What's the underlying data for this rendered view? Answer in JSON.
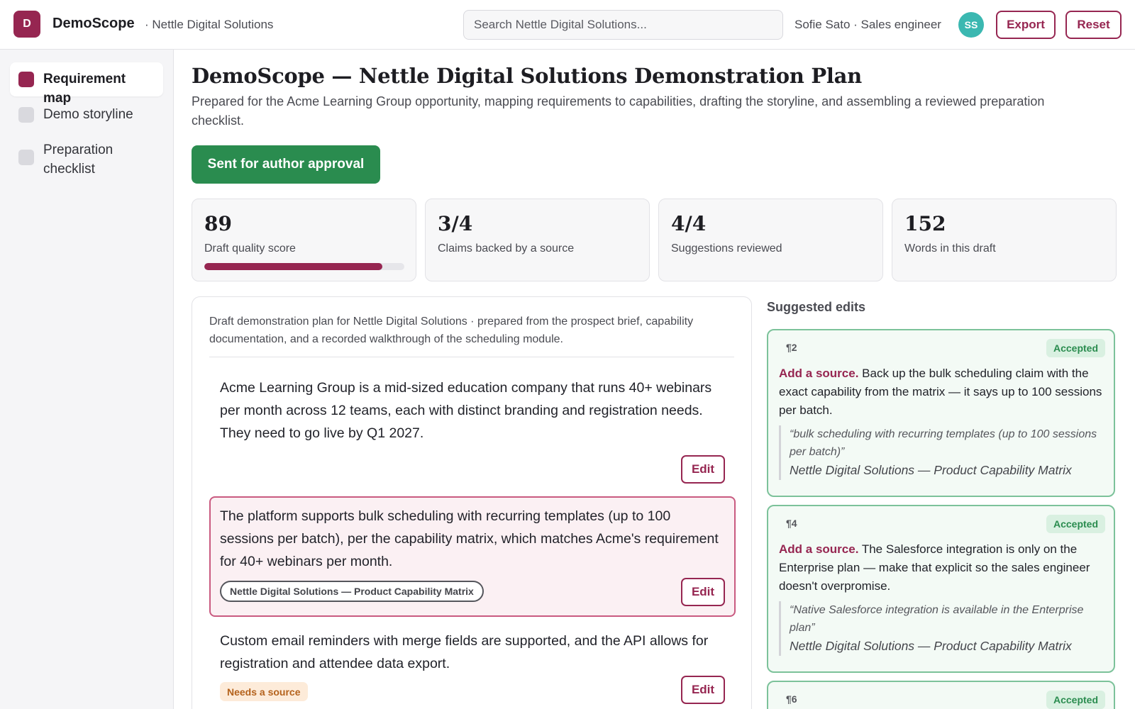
{
  "app": {
    "logo_letter": "D",
    "name": "DemoScope",
    "org": "· Nettle Digital Solutions"
  },
  "search": {
    "placeholder": "Search Nettle Digital Solutions..."
  },
  "user": {
    "label": "Sofie Sato · Sales engineer",
    "initials": "SS"
  },
  "toolbar": {
    "export_label": "Export",
    "reset_label": "Reset"
  },
  "sidebar": {
    "items": [
      {
        "label": "Requirement map",
        "active": true
      },
      {
        "label": "Demo storyline",
        "active": false
      },
      {
        "label": "Preparation checklist",
        "active": false
      }
    ]
  },
  "page": {
    "title": "DemoScope — Nettle Digital Solutions Demonstration Plan",
    "subtitle": "Prepared for the Acme Learning Group opportunity, mapping requirements to capabilities, drafting the storyline, and assembling a reviewed preparation checklist.",
    "status_button": "Sent for author approval"
  },
  "stats": [
    {
      "value": "89",
      "label": "Draft quality score",
      "progress": 0.89
    },
    {
      "value": "3/4",
      "label": "Claims backed by a source"
    },
    {
      "value": "4/4",
      "label": "Suggestions reviewed"
    },
    {
      "value": "152",
      "label": "Words in this draft"
    }
  ],
  "draft": {
    "intro": "Draft demonstration plan for Nettle Digital Solutions · prepared from the prospect brief, capability documentation, and a recorded walkthrough of the scheduling module.",
    "edit_label": "Edit",
    "paragraphs": [
      {
        "text": "Acme Learning Group is a mid-sized education company that runs 40+ webinars per month across 12 teams, each with distinct branding and registration needs. They need to go live by Q1 2027."
      },
      {
        "text": "The platform supports bulk scheduling with recurring templates (up to 100 sessions per batch), per the capability matrix, which matches Acme's requirement for 40+ webinars per month.",
        "source": "Nettle Digital Solutions — Product Capability Matrix"
      },
      {
        "text": "Custom email reminders with merge fields are supported, and the API allows for registration and attendee data export.",
        "badge": "Needs a source"
      }
    ]
  },
  "suggestions": {
    "heading": "Suggested edits",
    "items": [
      {
        "para": "¶2",
        "status": "Accepted",
        "action": "Add a source.",
        "body": "Back up the bulk scheduling claim with the exact capability from the matrix — it says up to 100 sessions per batch.",
        "quote": "“bulk scheduling with recurring templates (up to 100 sessions per batch)”",
        "source": "Nettle Digital Solutions — Product Capability Matrix"
      },
      {
        "para": "¶4",
        "status": "Accepted",
        "action": "Add a source.",
        "body": "The Salesforce integration is only on the Enterprise plan — make that explicit so the sales engineer doesn't overpromise.",
        "quote": "“Native Salesforce integration is available in the Enterprise plan”",
        "source": "Nettle Digital Solutions — Product Capability Matrix"
      },
      {
        "para": "¶6",
        "status": "Accepted"
      }
    ]
  },
  "colors": {
    "accent": "#962651",
    "success": "#2a8c4f",
    "avatar": "#3bb8b1",
    "warning": "#b4621c"
  }
}
